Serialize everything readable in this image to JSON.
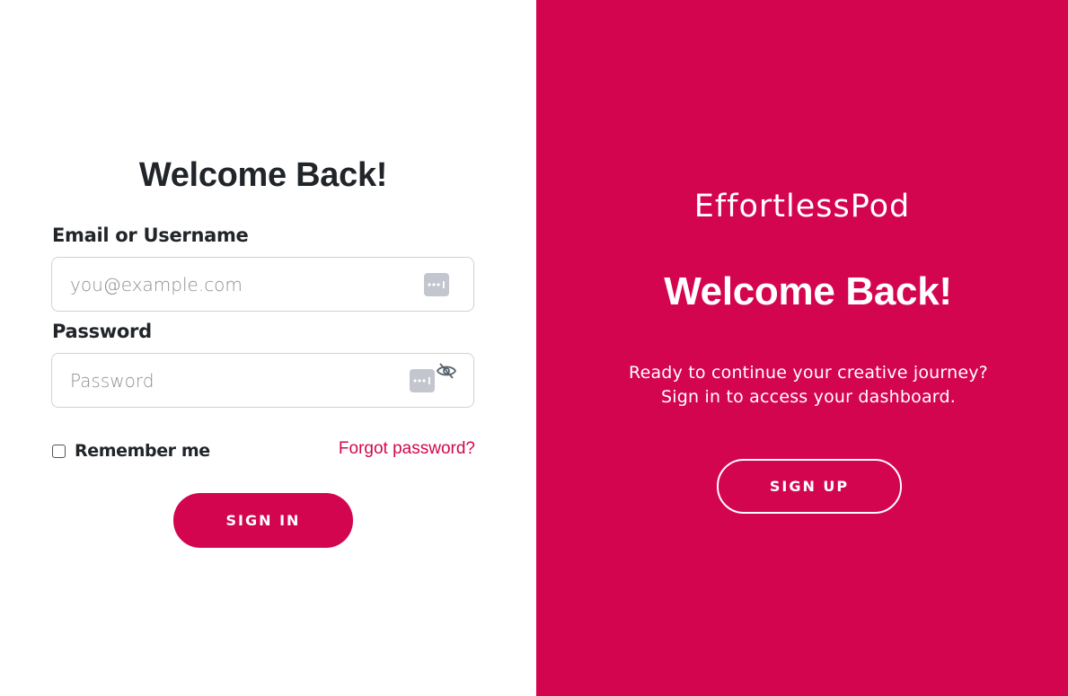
{
  "login": {
    "title": "Welcome Back!",
    "email_label": "Email or Username",
    "email_placeholder": "you@example.com",
    "email_value": "",
    "password_label": "Password",
    "password_placeholder": "Password",
    "password_value": "",
    "remember_label": "Remember me",
    "remember_checked": false,
    "forgot_link": "Forgot password?",
    "signin_button": "SIGN IN"
  },
  "promo": {
    "brand": "EffortlessPod",
    "title": "Welcome Back!",
    "tagline_line1": "Ready to continue your creative journey?",
    "tagline_line2": "Sign in to access your dashboard.",
    "signup_button": "SIGN UP"
  },
  "colors": {
    "accent": "#d4054f",
    "text_dark": "#212529",
    "input_border": "#cfd2d6",
    "autofill_icon": "#c3c6cf"
  },
  "icons": {
    "email_field": "password-manager-dots-icon",
    "password_field_autofill": "password-manager-dots-icon",
    "password_toggle": "eye-slash-icon",
    "brand_logo": "pen-logo-icon"
  }
}
